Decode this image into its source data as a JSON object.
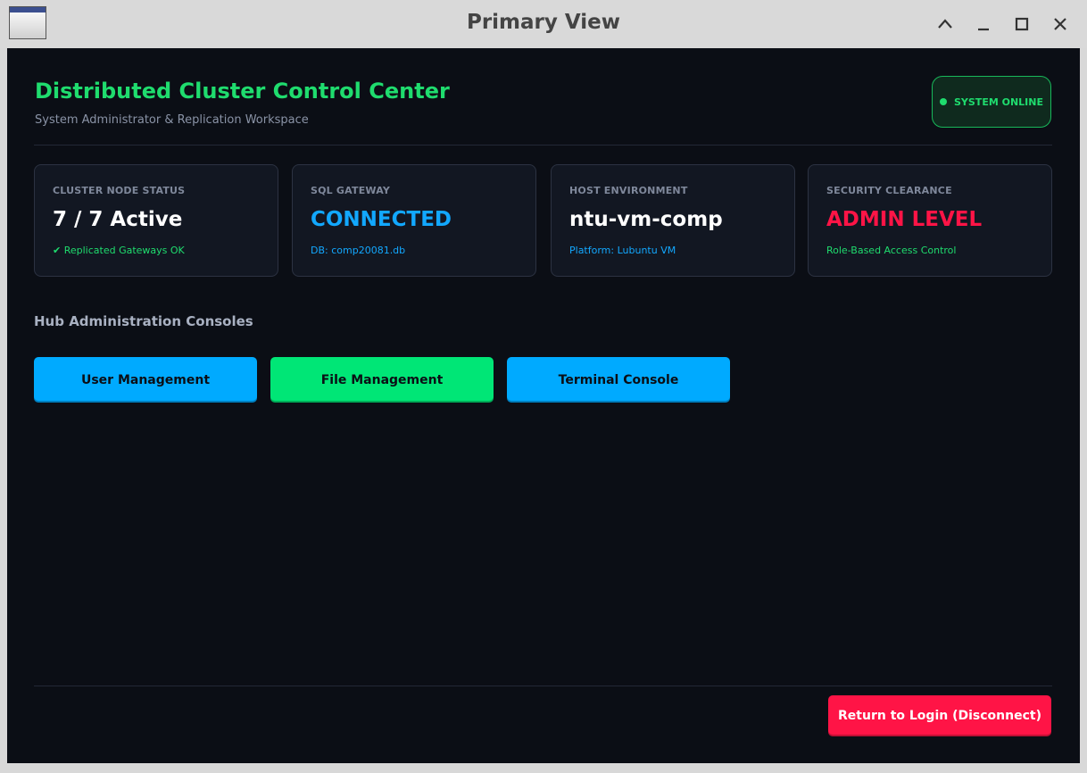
{
  "window": {
    "title": "Primary View",
    "controls": [
      "chevron-up-icon",
      "minimize-icon",
      "maximize-icon",
      "close-icon"
    ]
  },
  "header": {
    "title": "Distributed Cluster Control Center",
    "subtitle": "System Administrator & Replication Workspace",
    "status": "SYSTEM ONLINE"
  },
  "cards": [
    {
      "label": "CLUSTER NODE STATUS",
      "value": "7 / 7 Active",
      "note": "✔ Replicated Gateways OK",
      "value_color": "#ffffff",
      "note_color": "#1fdc6e"
    },
    {
      "label": "SQL GATEWAY",
      "value": "CONNECTED",
      "note": "DB: comp20081.db",
      "value_color": "#12a8ff",
      "note_color": "#12a8ff"
    },
    {
      "label": "HOST ENVIRONMENT",
      "value": "ntu-vm-comp",
      "note": "Platform: Lubuntu VM",
      "value_color": "#ffffff",
      "note_color": "#12a8ff"
    },
    {
      "label": "SECURITY CLEARANCE",
      "value": "ADMIN LEVEL",
      "note": "Role-Based Access Control",
      "value_color": "#ff1446",
      "note_color": "#1fdc6e"
    }
  ],
  "consoles": {
    "title": "Hub Administration Consoles",
    "buttons": [
      {
        "label": "User Management",
        "color": "#00aaff"
      },
      {
        "label": "File Management",
        "color": "#00e676"
      },
      {
        "label": "Terminal Console",
        "color": "#00aaff"
      }
    ]
  },
  "footer": {
    "logout_label": "Return to Login (Disconnect)"
  },
  "colors": {
    "background": "#0b0e15",
    "accent_green": "#1fdc6e",
    "accent_blue": "#12a8ff",
    "danger": "#ff1446"
  }
}
